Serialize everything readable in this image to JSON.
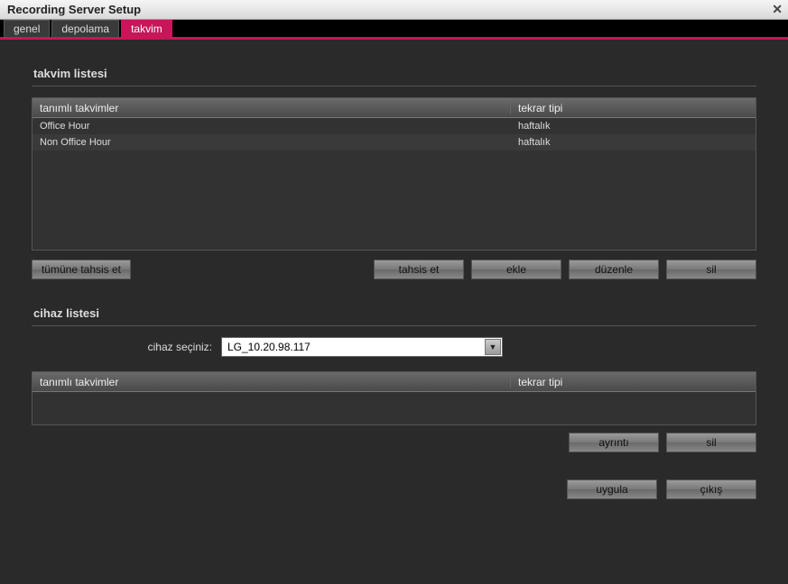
{
  "window": {
    "title": "Recording Server Setup",
    "close_glyph": "✕"
  },
  "tabs": {
    "items": [
      {
        "label": "genel"
      },
      {
        "label": "depolama"
      },
      {
        "label": "takvim"
      }
    ]
  },
  "calendar_section": {
    "title": "takvim listesi",
    "columns": {
      "c0": "tanımlı takvimler",
      "c1": "tekrar tipi"
    },
    "rows": [
      {
        "name": "Office Hour",
        "type": "haftalık"
      },
      {
        "name": "Non Office Hour",
        "type": "haftalık"
      }
    ],
    "buttons": {
      "allocate_all": "tümüne tahsis et",
      "allocate": "tahsis et",
      "add": "ekle",
      "edit": "düzenle",
      "delete": "sil"
    }
  },
  "device_section": {
    "title": "cihaz listesi",
    "device_label": "cihaz seçiniz:",
    "device_value": "LG_10.20.98.117",
    "columns": {
      "c0": "tanımlı takvimler",
      "c1": "tekrar tipi"
    },
    "buttons": {
      "detail": "ayrıntı",
      "delete": "sil"
    }
  },
  "footer": {
    "apply": "uygula",
    "exit": "çıkış"
  }
}
